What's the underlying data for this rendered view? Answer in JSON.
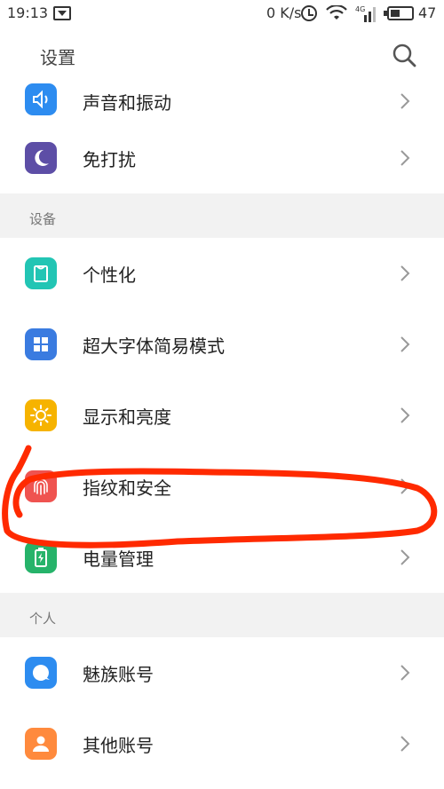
{
  "status_bar": {
    "time": "19:13",
    "network_speed": "0 K/s",
    "battery_level": "47",
    "battery_percent": 47
  },
  "header": {
    "title": "设置",
    "search_icon": "search-icon"
  },
  "items": [
    {
      "label": "声音和振动",
      "icon": "speaker-icon",
      "color": "#2d8cf0"
    },
    {
      "label": "免打扰",
      "icon": "moon-icon",
      "color": "#5d4ea6"
    }
  ],
  "section_device": {
    "label": "设备",
    "items": [
      {
        "label": "个性化",
        "icon": "shirt-icon",
        "color": "#22c5b4"
      },
      {
        "label": "超大字体简易模式",
        "icon": "grid-icon",
        "color": "#3a7be0"
      },
      {
        "label": "显示和亮度",
        "icon": "sun-icon",
        "color": "#f6b300"
      },
      {
        "label": "指纹和安全",
        "icon": "fingerprint-icon",
        "color": "#ef5350"
      },
      {
        "label": "电量管理",
        "icon": "battery-icon",
        "color": "#26b36a"
      }
    ]
  },
  "section_personal": {
    "label": "个人",
    "items": [
      {
        "label": "魅族账号",
        "icon": "meizu-icon",
        "color": "#2d8cf0"
      },
      {
        "label": "其他账号",
        "icon": "person-icon",
        "color": "#ff8a3d"
      }
    ]
  },
  "annotation_color": "#ff2a00"
}
